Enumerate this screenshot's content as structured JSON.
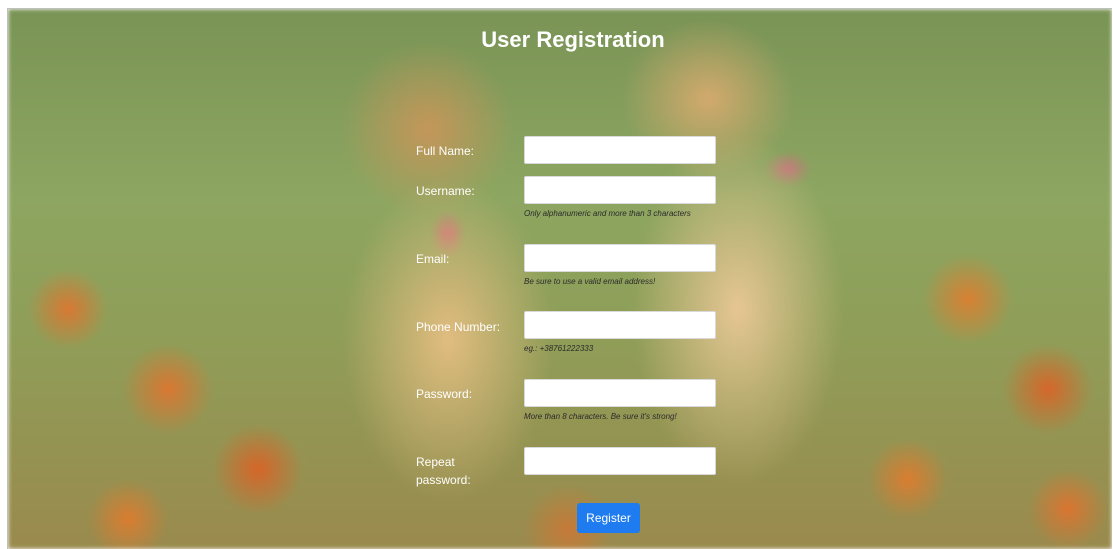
{
  "form": {
    "title": "User Registration",
    "fields": [
      {
        "label": "Full Name:",
        "value": "",
        "hint": ""
      },
      {
        "label": "Username:",
        "value": "",
        "hint": "Only alphanumeric and more than 3 characters"
      },
      {
        "label": "Email:",
        "value": "",
        "hint": "Be sure to use a valid email address!"
      },
      {
        "label": "Phone Number:",
        "value": "",
        "hint": "eg.: +38761222333"
      },
      {
        "label": "Password:",
        "value": "",
        "hint": "More than 8 characters. Be sure it's strong!"
      },
      {
        "label": "Repeat password:",
        "value": "",
        "hint": ""
      }
    ],
    "register_label": "Register"
  },
  "colors": {
    "accent": "#1e7cf0",
    "label": "#ffffff"
  }
}
